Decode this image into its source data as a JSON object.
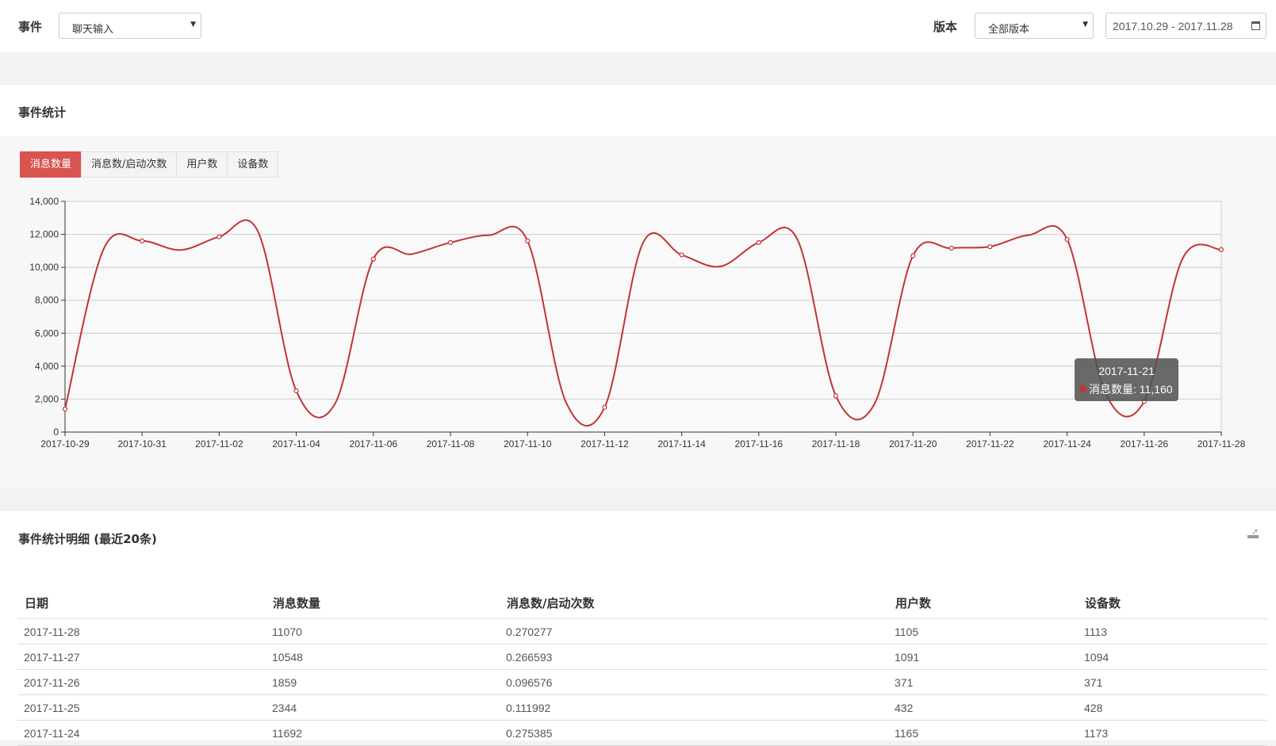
{
  "filters": {
    "event_label": "事件",
    "event_value": "聊天输入",
    "version_label": "版本",
    "version_value": "全部版本",
    "date_range": "2017.10.29 - 2017.11.28"
  },
  "stats_panel": {
    "title": "事件统计",
    "tabs": [
      {
        "label": "消息数量",
        "active": true
      },
      {
        "label": "消息数/启动次数",
        "active": false
      },
      {
        "label": "用户数",
        "active": false
      },
      {
        "label": "设备数",
        "active": false
      }
    ]
  },
  "tooltip": {
    "date": "2017-11-21",
    "series": "消息数量",
    "value": "11,160"
  },
  "chart_data": {
    "type": "line",
    "series": [
      {
        "name": "消息数量",
        "color": "#c23531"
      }
    ],
    "x_ticks": [
      "2017-10-29",
      "2017-10-31",
      "2017-11-02",
      "2017-11-04",
      "2017-11-06",
      "2017-11-08",
      "2017-11-10",
      "2017-11-12",
      "2017-11-14",
      "2017-11-16",
      "2017-11-18",
      "2017-11-20",
      "2017-11-22",
      "2017-11-24",
      "2017-11-26",
      "2017-11-28"
    ],
    "y_ticks": [
      "0",
      "2,000",
      "4,000",
      "6,000",
      "8,000",
      "10,000",
      "12,000",
      "14,000"
    ],
    "ylim": [
      0,
      14000
    ],
    "grid": true,
    "points": [
      {
        "x": "2017-10-29",
        "y": 1400
      },
      {
        "x": "2017-10-30",
        "y": 11100
      },
      {
        "x": "2017-10-31",
        "y": 11600
      },
      {
        "x": "2017-11-01",
        "y": 11050
      },
      {
        "x": "2017-11-02",
        "y": 11850
      },
      {
        "x": "2017-11-03",
        "y": 12200
      },
      {
        "x": "2017-11-04",
        "y": 2500
      },
      {
        "x": "2017-11-05",
        "y": 1700
      },
      {
        "x": "2017-11-06",
        "y": 10500
      },
      {
        "x": "2017-11-07",
        "y": 10800
      },
      {
        "x": "2017-11-08",
        "y": 11500
      },
      {
        "x": "2017-11-09",
        "y": 11950
      },
      {
        "x": "2017-11-10",
        "y": 11600
      },
      {
        "x": "2017-11-11",
        "y": 1800
      },
      {
        "x": "2017-11-12",
        "y": 1500
      },
      {
        "x": "2017-11-13",
        "y": 11500
      },
      {
        "x": "2017-11-14",
        "y": 10750
      },
      {
        "x": "2017-11-15",
        "y": 10050
      },
      {
        "x": "2017-11-16",
        "y": 11500
      },
      {
        "x": "2017-11-17",
        "y": 11700
      },
      {
        "x": "2017-11-18",
        "y": 2200
      },
      {
        "x": "2017-11-19",
        "y": 1700
      },
      {
        "x": "2017-11-20",
        "y": 10700
      },
      {
        "x": "2017-11-21",
        "y": 11160
      },
      {
        "x": "2017-11-22",
        "y": 11250
      },
      {
        "x": "2017-11-23",
        "y": 11950
      },
      {
        "x": "2017-11-24",
        "y": 11692
      },
      {
        "x": "2017-11-25",
        "y": 2344
      },
      {
        "x": "2017-11-26",
        "y": 1859
      },
      {
        "x": "2017-11-27",
        "y": 10548
      },
      {
        "x": "2017-11-28",
        "y": 11070
      }
    ]
  },
  "detail_panel": {
    "title": "事件统计明细 (最近20条)",
    "columns": [
      "日期",
      "消息数量",
      "消息数/启动次数",
      "用户数",
      "设备数"
    ],
    "rows": [
      [
        "2017-11-28",
        "11070",
        "0.270277",
        "1105",
        "1113"
      ],
      [
        "2017-11-27",
        "10548",
        "0.266593",
        "1091",
        "1094"
      ],
      [
        "2017-11-26",
        "1859",
        "0.096576",
        "371",
        "371"
      ],
      [
        "2017-11-25",
        "2344",
        "0.111992",
        "432",
        "428"
      ],
      [
        "2017-11-24",
        "11692",
        "0.275385",
        "1165",
        "1173"
      ]
    ]
  }
}
